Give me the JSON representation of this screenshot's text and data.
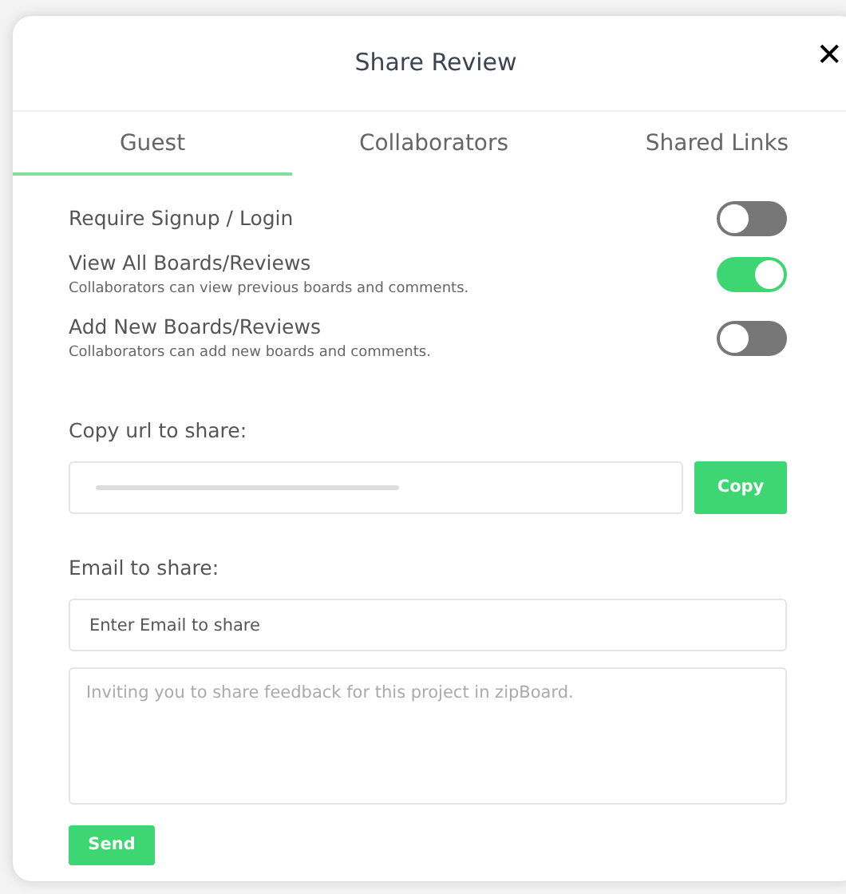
{
  "dialog": {
    "title": "Share Review",
    "close": "✕"
  },
  "tabs": [
    {
      "label": "Guest",
      "selected": true
    },
    {
      "label": "Collaborators",
      "selected": false
    },
    {
      "label": "Shared Links",
      "selected": false
    }
  ],
  "settings": [
    {
      "label": "Require Signup / Login",
      "on": false
    },
    {
      "label": "View All Boards/Reviews",
      "description": "Collaborators can view previous boards and comments.",
      "on": true
    },
    {
      "label": "Add New Boards/Reviews",
      "description": "Collaborators can add new boards and comments.",
      "on": false
    }
  ],
  "copy_url": {
    "label": "Copy url to share:",
    "button": "Copy"
  },
  "email": {
    "label": "Email to share:",
    "placeholder": "Enter Email to share",
    "message_placeholder": "Inviting you to share feedback for this project in zipBoard.",
    "button": "Send"
  }
}
